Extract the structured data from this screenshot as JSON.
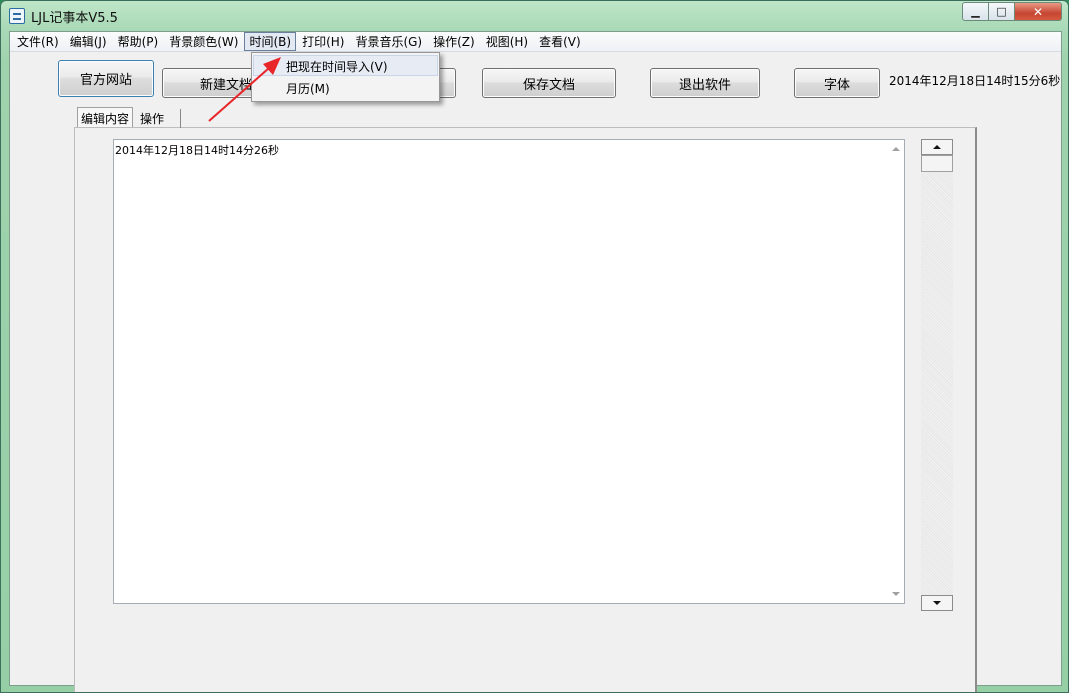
{
  "window": {
    "title": "LJL记事本V5.5",
    "controls": {
      "minimize": "▁",
      "maximize": "□",
      "close": "✕"
    }
  },
  "menubar": {
    "items": [
      "文件(R)",
      "编辑(J)",
      "帮助(P)",
      "背景颜色(W)",
      "时间(B)",
      "打印(H)",
      "背景音乐(G)",
      "操作(Z)",
      "视图(H)",
      "查看(V)"
    ],
    "active_index": 4
  },
  "dropdown": {
    "items": [
      "把现在时间导入(V)",
      "月历(M)"
    ],
    "highlighted_index": 0
  },
  "toolbar": {
    "official_site": "官方网站",
    "new_doc": "新建文档",
    "save_doc": "保存文档",
    "exit": "退出软件",
    "font": "字体",
    "datetime": "2014年12月18日14时15分6秒"
  },
  "tabs": {
    "edit_content": "编辑内容",
    "operations": "操作"
  },
  "editor": {
    "content": "2014年12月18日14时14分26秒"
  },
  "colors": {
    "window_frame": "#9fd3ad",
    "client_bg": "#f0f0f0",
    "annotation_arrow": "#e8262a",
    "close_button": "#c64632"
  },
  "icons": {
    "app": "notebook-icon",
    "scroll_up": "triangle-up-icon",
    "scroll_down": "triangle-down-icon"
  }
}
